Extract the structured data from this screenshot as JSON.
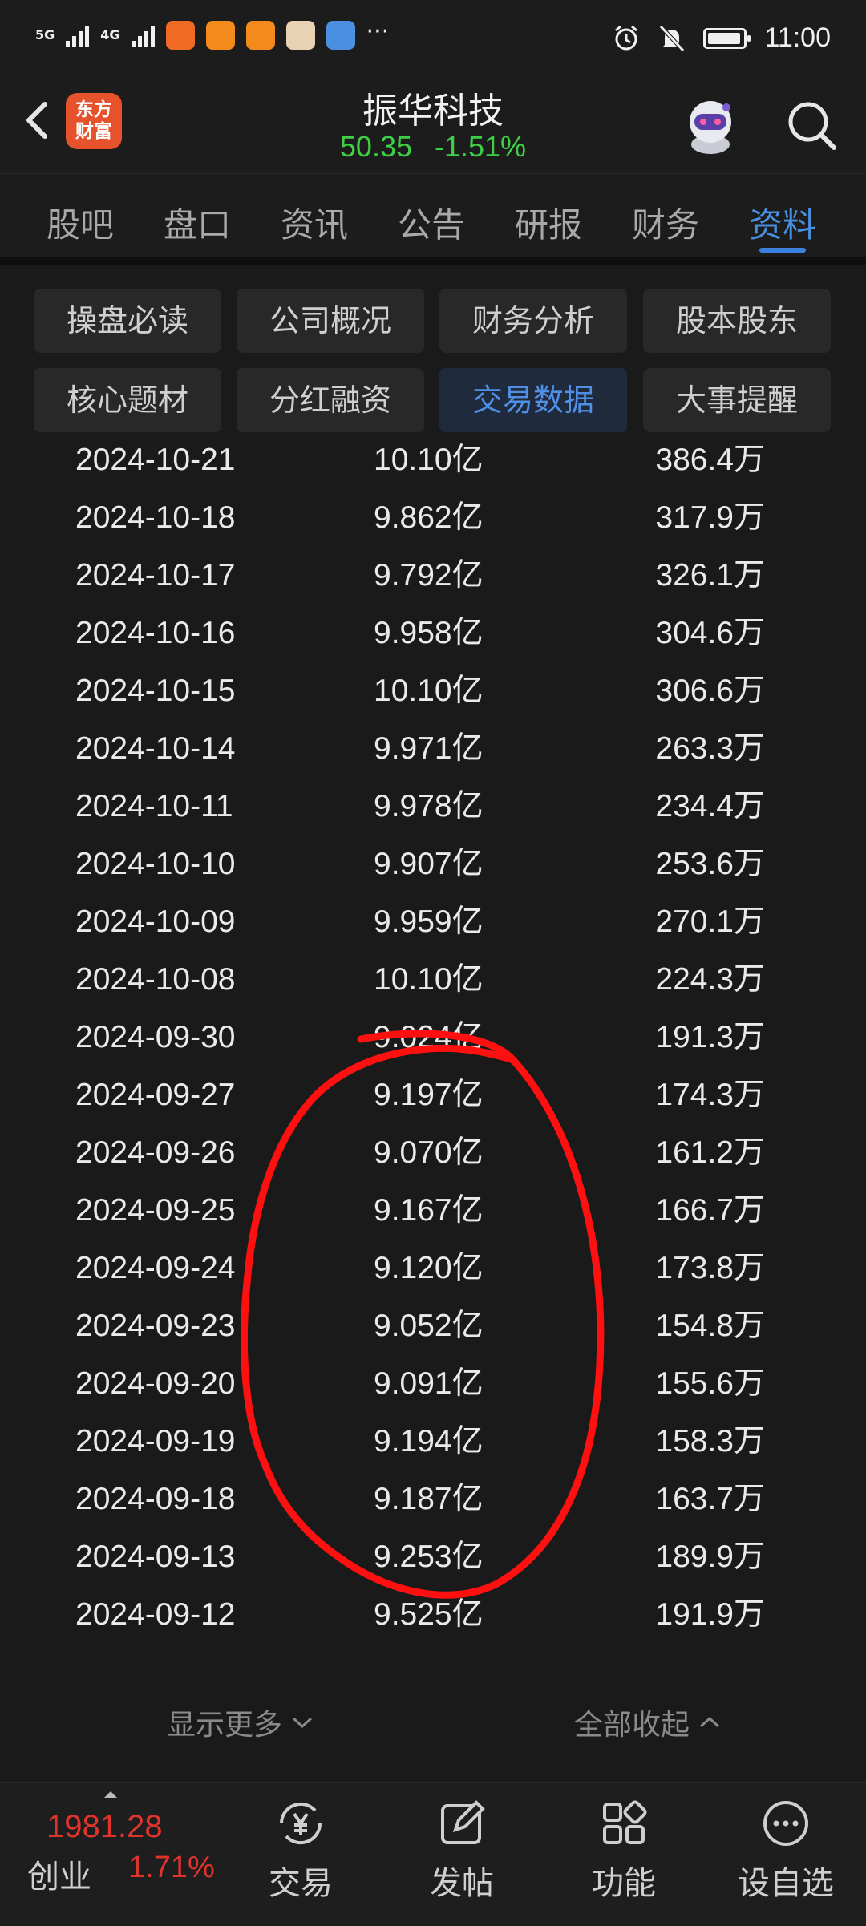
{
  "status_bar": {
    "network_1": "5G",
    "network_2": "4G",
    "time": "11:00"
  },
  "header": {
    "back_icon": "chevron-left-icon",
    "logo_line1": "东方",
    "logo_line2": "财富",
    "stock_name": "振华科技",
    "price": "50.35",
    "change_pct": "-1.51%",
    "price_color": "#3fcf46"
  },
  "tabs": [
    {
      "label": "股吧"
    },
    {
      "label": "盘口"
    },
    {
      "label": "资讯"
    },
    {
      "label": "公告"
    },
    {
      "label": "研报"
    },
    {
      "label": "财务"
    },
    {
      "label": "资料",
      "active": true
    }
  ],
  "chips": [
    {
      "label": "操盘必读"
    },
    {
      "label": "公司概况"
    },
    {
      "label": "财务分析"
    },
    {
      "label": "股本股东"
    },
    {
      "label": "核心题材"
    },
    {
      "label": "分红融资"
    },
    {
      "label": "交易数据",
      "active": true
    },
    {
      "label": "大事提醒"
    }
  ],
  "rows": [
    {
      "date": "2024-10-21",
      "amount": "10.10亿",
      "volume": "386.4万"
    },
    {
      "date": "2024-10-18",
      "amount": "9.862亿",
      "volume": "317.9万"
    },
    {
      "date": "2024-10-17",
      "amount": "9.792亿",
      "volume": "326.1万"
    },
    {
      "date": "2024-10-16",
      "amount": "9.958亿",
      "volume": "304.6万"
    },
    {
      "date": "2024-10-15",
      "amount": "10.10亿",
      "volume": "306.6万"
    },
    {
      "date": "2024-10-14",
      "amount": "9.971亿",
      "volume": "263.3万"
    },
    {
      "date": "2024-10-11",
      "amount": "9.978亿",
      "volume": "234.4万"
    },
    {
      "date": "2024-10-10",
      "amount": "9.907亿",
      "volume": "253.6万"
    },
    {
      "date": "2024-10-09",
      "amount": "9.959亿",
      "volume": "270.1万"
    },
    {
      "date": "2024-10-08",
      "amount": "10.10亿",
      "volume": "224.3万"
    },
    {
      "date": "2024-09-30",
      "amount": "9.024亿",
      "volume": "191.3万"
    },
    {
      "date": "2024-09-27",
      "amount": "9.197亿",
      "volume": "174.3万"
    },
    {
      "date": "2024-09-26",
      "amount": "9.070亿",
      "volume": "161.2万"
    },
    {
      "date": "2024-09-25",
      "amount": "9.167亿",
      "volume": "166.7万"
    },
    {
      "date": "2024-09-24",
      "amount": "9.120亿",
      "volume": "173.8万"
    },
    {
      "date": "2024-09-23",
      "amount": "9.052亿",
      "volume": "154.8万"
    },
    {
      "date": "2024-09-20",
      "amount": "9.091亿",
      "volume": "155.6万"
    },
    {
      "date": "2024-09-19",
      "amount": "9.194亿",
      "volume": "158.3万"
    },
    {
      "date": "2024-09-18",
      "amount": "9.187亿",
      "volume": "163.7万"
    },
    {
      "date": "2024-09-13",
      "amount": "9.253亿",
      "volume": "189.9万"
    },
    {
      "date": "2024-09-12",
      "amount": "9.525亿",
      "volume": "191.9万"
    }
  ],
  "footer": {
    "show_more": "显示更多",
    "collapse_all": "全部收起"
  },
  "bottom_nav": {
    "index_value": "1981.28",
    "index_name": "创业",
    "index_pct": "1.71%",
    "items": [
      {
        "label": "交易",
        "icon": "trade-yen-icon"
      },
      {
        "label": "发帖",
        "icon": "compose-icon"
      },
      {
        "label": "功能",
        "icon": "grid-icon"
      },
      {
        "label": "设自选",
        "icon": "more-circle-icon"
      }
    ]
  },
  "colors": {
    "accent_blue": "#4a90e2",
    "down_green": "#3fcf46",
    "up_red": "#e0332b",
    "annotation_red": "#ff1010"
  }
}
